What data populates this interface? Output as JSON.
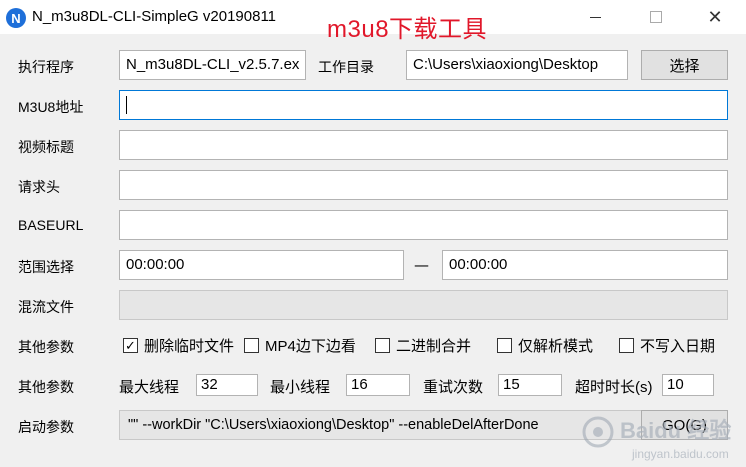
{
  "window": {
    "app_icon_letter": "N",
    "title": "N_m3u8DL-CLI-SimpleG v20190811",
    "overlay_title": "m3u8下载工具",
    "close_glyph": "✕"
  },
  "row_exe": {
    "label": "执行程序",
    "value": "N_m3u8DL-CLI_v2.5.7.ex",
    "workdir_label": "工作目录",
    "workdir_value": "C:\\Users\\xiaoxiong\\Desktop",
    "select_button": "选择"
  },
  "fields": {
    "m3u8_label": "M3U8地址",
    "m3u8_value": "",
    "title_label": "视频标题",
    "title_value": "",
    "headers_label": "请求头",
    "headers_value": "",
    "baseurl_label": "BASEURL",
    "baseurl_value": ""
  },
  "range": {
    "label": "范围选择",
    "start": "00:00:00",
    "separator": "—",
    "end": "00:00:00"
  },
  "mux": {
    "label": "混流文件",
    "value": ""
  },
  "options": {
    "label": "其他参数",
    "checkboxes": [
      {
        "label": "删除临时文件",
        "checked": true
      },
      {
        "label": "MP4边下边看",
        "checked": false
      },
      {
        "label": "二进制合并",
        "checked": false
      },
      {
        "label": "仅解析模式",
        "checked": false
      },
      {
        "label": "不写入日期",
        "checked": false
      }
    ]
  },
  "params": {
    "label": "其他参数",
    "max_threads_label": "最大线程",
    "max_threads": "32",
    "min_threads_label": "最小线程",
    "min_threads": "16",
    "retry_label": "重试次数",
    "retry": "15",
    "timeout_label": "超时时长(s)",
    "timeout": "10"
  },
  "launch": {
    "label": "启动参数",
    "value": "\"\" --workDir \"C:\\Users\\xiaoxiong\\Desktop\" --enableDelAfterDone",
    "go_button": "GO(G)"
  },
  "watermark": {
    "text": "Baidu 经验",
    "url": "jingyan.baidu.com"
  }
}
